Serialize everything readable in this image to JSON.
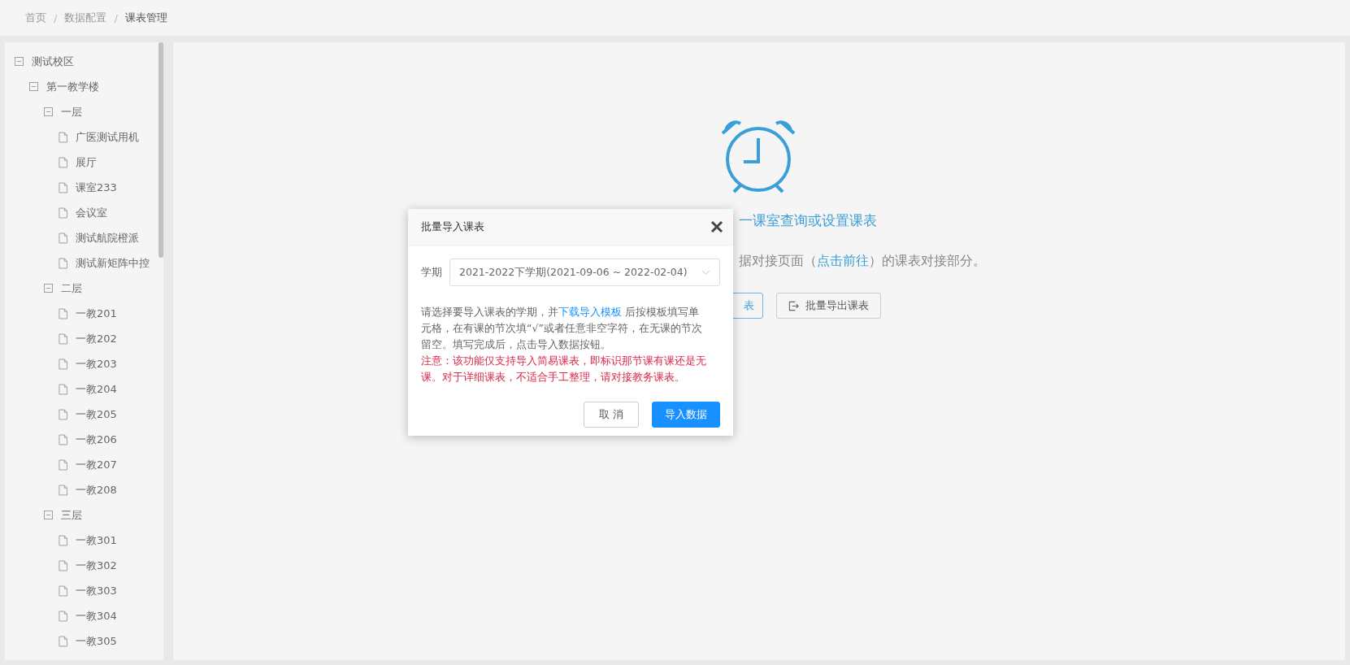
{
  "breadcrumb": {
    "separator": "/",
    "items": [
      {
        "label": "首页",
        "current": false
      },
      {
        "label": "数据配置",
        "current": false
      },
      {
        "label": "课表管理",
        "current": true
      }
    ]
  },
  "tree": [
    {
      "label": "测试校区",
      "expanded": true,
      "children": [
        {
          "label": "第一教学楼",
          "expanded": true,
          "children": [
            {
              "label": "一层",
              "expanded": true,
              "children": [
                {
                  "label": "广医测试用机"
                },
                {
                  "label": "展厅"
                },
                {
                  "label": "课室233"
                },
                {
                  "label": "会议室"
                },
                {
                  "label": "测试航院橙派"
                },
                {
                  "label": "测试新矩阵中控"
                }
              ]
            },
            {
              "label": "二层",
              "expanded": true,
              "children": [
                {
                  "label": "一教201"
                },
                {
                  "label": "一教202"
                },
                {
                  "label": "一教203"
                },
                {
                  "label": "一教204"
                },
                {
                  "label": "一教205"
                },
                {
                  "label": "一教206"
                },
                {
                  "label": "一教207"
                },
                {
                  "label": "一教208"
                }
              ]
            },
            {
              "label": "三层",
              "expanded": true,
              "children": [
                {
                  "label": "一教301"
                },
                {
                  "label": "一教302"
                },
                {
                  "label": "一教303"
                },
                {
                  "label": "一教304"
                },
                {
                  "label": "一教305"
                }
              ]
            }
          ]
        }
      ]
    }
  ],
  "main": {
    "hint_title": "一课室查询或设置课表",
    "hint_before": "据对接页面（",
    "hint_link": "点击前往",
    "hint_after": "）的课表对接部分。",
    "buttons": [
      {
        "label": "表",
        "kind": "primary"
      },
      {
        "label": "批量导出课表",
        "kind": "export"
      }
    ]
  },
  "dialog": {
    "title": "批量导入课表",
    "term_label": "学期",
    "term_value": "2021-2022下学期(2021-09-06 ~ 2022-02-04)",
    "text_before": "请选择要导入课表的学期，并",
    "text_link": "下载导入模板",
    "text_after": " 后按模板填写单元格，在有课的节次填“√”或者任意非空字符，在无课的节次留空。填写完成后，点击导入数据按钮。",
    "warning": "注意：该功能仅支持导入简易课表，即标识那节课有课还是无课。对于详细课表，不适合手工整理，请对接教务课表。",
    "buttons": [
      {
        "label": "取 消",
        "kind": "default"
      },
      {
        "label": "导入数据",
        "kind": "primary"
      }
    ]
  }
}
